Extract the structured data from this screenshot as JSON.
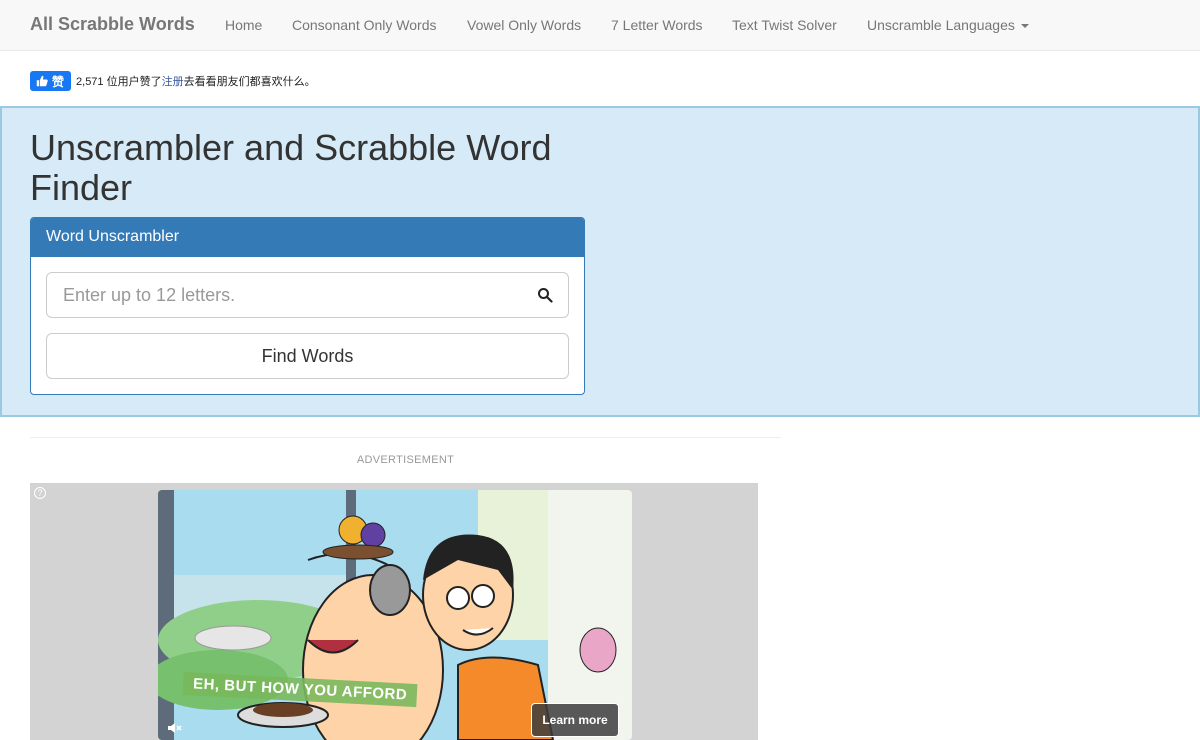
{
  "navbar": {
    "brand": "All Scrabble Words",
    "items": [
      {
        "label": "Home"
      },
      {
        "label": "Consonant Only Words"
      },
      {
        "label": "Vowel Only Words"
      },
      {
        "label": "7 Letter Words"
      },
      {
        "label": "Text Twist Solver"
      },
      {
        "label": "Unscramble Languages"
      }
    ]
  },
  "facebook": {
    "like_label": "赞",
    "count_text": "2,571 位用户赞了",
    "link_text": "注册",
    "suffix_text": "去看看朋友们都喜欢什么。"
  },
  "hero": {
    "title": "Unscrambler and Scrabble Word Finder"
  },
  "unscrambler": {
    "heading": "Word Unscrambler",
    "placeholder": "Enter up to 12 letters.",
    "button": "Find Words"
  },
  "ad": {
    "label": "ADVERTISEMENT",
    "caption": "EH, BUT HOW YOU AFFORD",
    "learn_more": "Learn more",
    "info": "?"
  },
  "colors": {
    "primary": "#337ab7",
    "hero_bg": "#d6ebf7",
    "hero_border": "#9cc9e2",
    "fb_blue": "#1877f2"
  },
  "icons": [
    "thumbs-up-icon",
    "search-icon",
    "caret-down-icon",
    "ad-info-icon",
    "mute-icon"
  ]
}
